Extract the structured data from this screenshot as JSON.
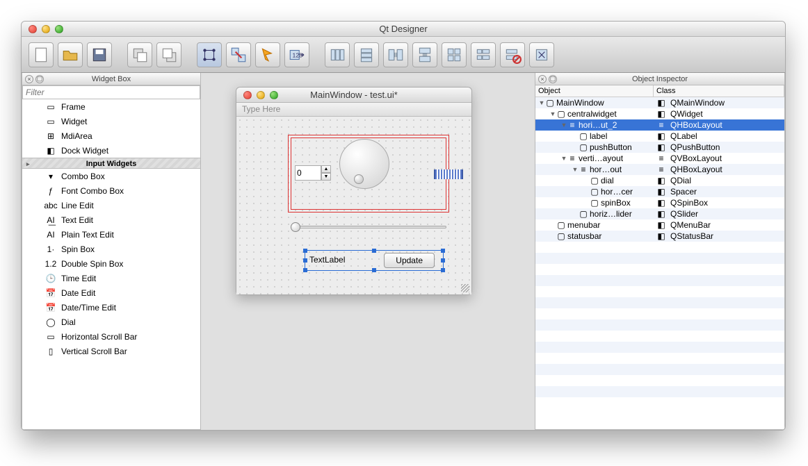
{
  "app": {
    "title": "Qt Designer"
  },
  "design": {
    "title": "MainWindow - test.ui*",
    "menubar_hint": "Type Here",
    "spin_value": "0",
    "text_label": "TextLabel",
    "button_label": "Update"
  },
  "widget_box": {
    "title": "Widget Box",
    "filter_placeholder": "Filter",
    "groups": [
      {
        "type": "item",
        "label": "Frame"
      },
      {
        "type": "item",
        "label": "Widget"
      },
      {
        "type": "item",
        "label": "MdiArea"
      },
      {
        "type": "item",
        "label": "Dock Widget"
      },
      {
        "type": "group",
        "label": "Input Widgets"
      },
      {
        "type": "item",
        "label": "Combo Box"
      },
      {
        "type": "item",
        "label": "Font Combo Box"
      },
      {
        "type": "item",
        "label": "Line Edit"
      },
      {
        "type": "item",
        "label": "Text Edit"
      },
      {
        "type": "item",
        "label": "Plain Text Edit"
      },
      {
        "type": "item",
        "label": "Spin Box"
      },
      {
        "type": "item",
        "label": "Double Spin Box"
      },
      {
        "type": "item",
        "label": "Time Edit"
      },
      {
        "type": "item",
        "label": "Date Edit"
      },
      {
        "type": "item",
        "label": "Date/Time Edit"
      },
      {
        "type": "item",
        "label": "Dial"
      },
      {
        "type": "item",
        "label": "Horizontal Scroll Bar"
      },
      {
        "type": "item",
        "label": "Vertical Scroll Bar"
      }
    ]
  },
  "object_inspector": {
    "title": "Object Inspector",
    "col1": "Object",
    "col2": "Class",
    "rows": [
      {
        "indent": 0,
        "arrow": "▼",
        "name": "MainWindow",
        "class": "QMainWindow"
      },
      {
        "indent": 1,
        "arrow": "▼",
        "name": "centralwidget",
        "class": "QWidget"
      },
      {
        "indent": 2,
        "arrow": "▼",
        "name": "hori…ut_2",
        "class": "QHBoxLayout",
        "selected": true
      },
      {
        "indent": 3,
        "arrow": "",
        "name": "label",
        "class": "QLabel"
      },
      {
        "indent": 3,
        "arrow": "",
        "name": "pushButton",
        "class": "QPushButton"
      },
      {
        "indent": 2,
        "arrow": "▼",
        "name": "verti…ayout",
        "class": "QVBoxLayout"
      },
      {
        "indent": 3,
        "arrow": "▼",
        "name": "hor…out",
        "class": "QHBoxLayout"
      },
      {
        "indent": 4,
        "arrow": "",
        "name": "dial",
        "class": "QDial"
      },
      {
        "indent": 4,
        "arrow": "",
        "name": "hor…cer",
        "class": "Spacer"
      },
      {
        "indent": 4,
        "arrow": "",
        "name": "spinBox",
        "class": "QSpinBox"
      },
      {
        "indent": 3,
        "arrow": "",
        "name": "horiz…lider",
        "class": "QSlider"
      },
      {
        "indent": 1,
        "arrow": "",
        "name": "menubar",
        "class": "QMenuBar"
      },
      {
        "indent": 1,
        "arrow": "",
        "name": "statusbar",
        "class": "QStatusBar"
      }
    ]
  }
}
